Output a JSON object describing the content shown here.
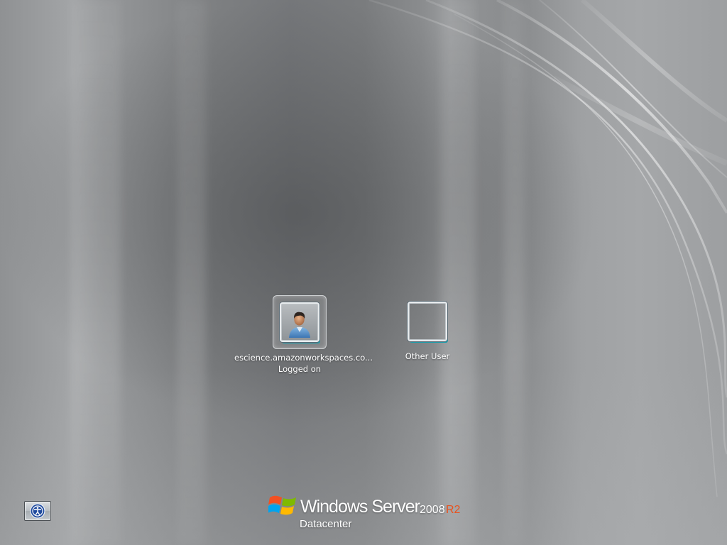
{
  "users": [
    {
      "name": "escience.amazonworkspaces.co...",
      "status": "Logged on",
      "picture": "user-avatar-icon"
    },
    {
      "name": "Other User",
      "picture": "blank-tile"
    }
  ],
  "accessibility": {
    "icon": "ease-of-access-icon"
  },
  "branding": {
    "product": "Windows Server",
    "version": "2008",
    "release": "R2",
    "edition": "Datacenter",
    "logo": "windows-flag-logo"
  },
  "colors": {
    "release_accent": "#e8521f",
    "tile_accent": "#1d9aa8"
  }
}
